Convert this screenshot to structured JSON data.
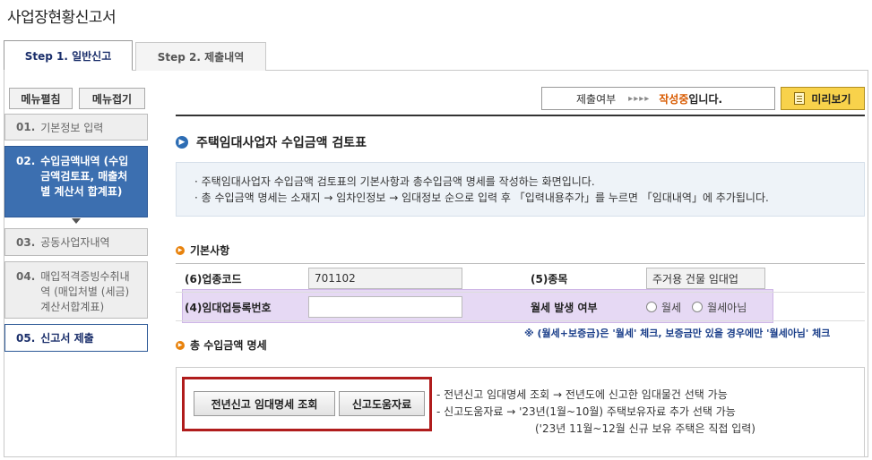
{
  "page": {
    "title": "사업장현황신고서"
  },
  "tabs": [
    {
      "label": "Step 1. 일반신고"
    },
    {
      "label": "Step 2. 제출내역"
    }
  ],
  "sidebar": {
    "expand_label": "메뉴펼침",
    "collapse_label": "메뉴접기",
    "steps": [
      {
        "num": "01.",
        "label": "기본정보 입력"
      },
      {
        "num": "02.",
        "label": "수입금액내역 (수입금액검토표, 매출처별 계산서 합계표)"
      },
      {
        "num": "03.",
        "label": "공동사업자내역"
      },
      {
        "num": "04.",
        "label": "매입적격증빙수취내역 (매입처별 (세금) 계산서합계표)"
      },
      {
        "num": "05.",
        "label": "신고서 제출"
      }
    ]
  },
  "status": {
    "prefix": "제출여부",
    "arrows": "▸▸▸▸",
    "state": "작성중",
    "suffix": "입니다.",
    "preview_label": "미리보기"
  },
  "section": {
    "title": "주택임대사업자 수입금액 검토표"
  },
  "info": {
    "line1": "주택임대사업자 수입금액 검토표의 기본사항과 총수입금액 명세를 작성하는 화면입니다.",
    "line2": "총 수입금액 명세는 소재지 → 임차인정보 → 임대정보 순으로 입력 후 「입력내용추가」를 누르면 「임대내역」에 추가됩니다."
  },
  "basic": {
    "title": "기본사항",
    "industry_code_label": "(6)업종코드",
    "industry_code_value": "701102",
    "category_label": "(5)종목",
    "category_value": "주거용 건물 임대업",
    "reg_no_label": "(4)임대업등록번호",
    "reg_no_value": "",
    "monthly_rent_label": "월세 발생 여부",
    "radio_yes": "월세",
    "radio_no": "월세아님"
  },
  "note": "※ (월세+보증금)은 '월세' 체크, 보증금만 있을 경우에만 '월세아님' 체크",
  "revenue": {
    "title": "총 수입금액 명세",
    "prev_lookup_button": "전년신고 임대명세 조회",
    "help_data_button": "신고도움자료",
    "desc1": "전년신고 임대명세 조회 → 전년도에 신고한 임대물건 선택 가능",
    "desc2": "신고도움자료 → '23년(1월~10월) 주택보유자료 추가 선택 가능",
    "desc3": "('23년 11월~12월 신규 보유 주택은 직접 입력)"
  },
  "colors": {
    "active_step": "#3c6fb0",
    "status_state": "#d85a00",
    "preview_button": "#f8d24b",
    "highlight": "#c8aae6",
    "red_frame": "#b01c1c"
  }
}
